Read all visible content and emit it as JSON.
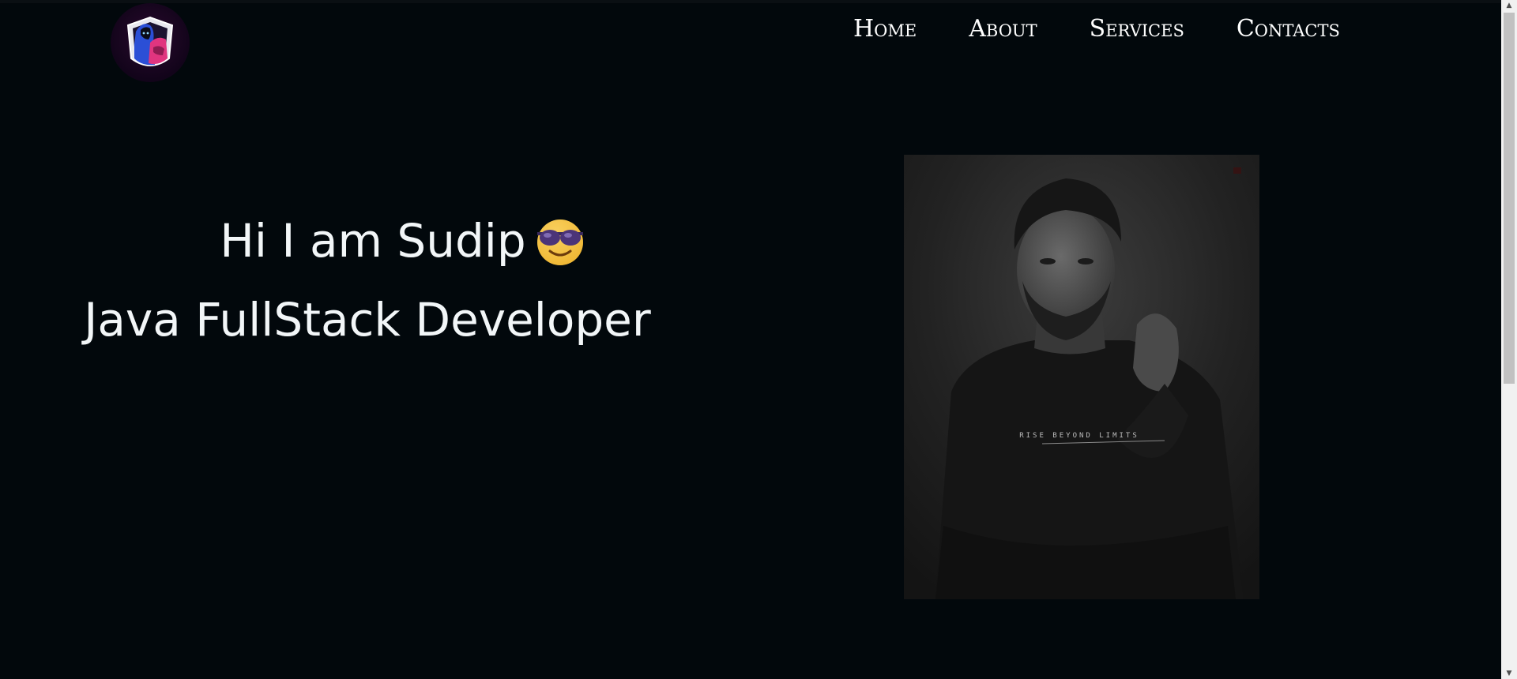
{
  "nav": {
    "items": [
      {
        "label": "Home"
      },
      {
        "label": "About"
      },
      {
        "label": "Services"
      },
      {
        "label": "Contacts"
      }
    ]
  },
  "hero": {
    "greeting": "Hi I am Sudip",
    "greeting_emoji": "smiling-face-with-sunglasses-icon",
    "title": "Java FullStack Developer"
  },
  "portrait": {
    "shirt_text": "RISE BEYOND LIMITS"
  },
  "colors": {
    "background": "#02080c",
    "text": "#f2f6f8",
    "nav_text": "#ffffff"
  }
}
